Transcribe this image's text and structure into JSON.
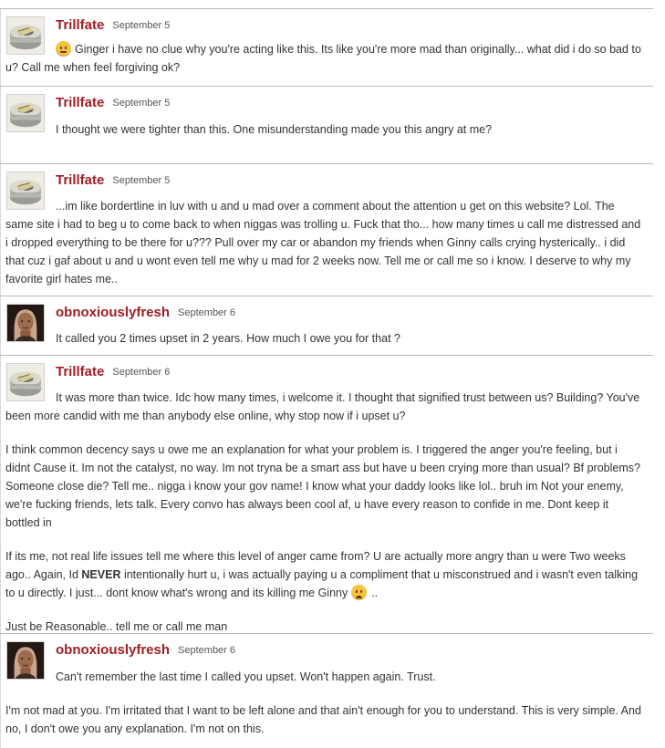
{
  "posts": [
    {
      "author": "Trillfate",
      "date": "September 5",
      "avatar": "tape-roll-avatar",
      "paragraphs": [
        "Ginger i have no clue why you're acting like this. Its like you're more mad than originally... what did i do so bad to u? Call me when feel forgiving ok?"
      ]
    },
    {
      "author": "Trillfate",
      "date": "September 5",
      "avatar": "tape-roll-avatar",
      "paragraphs": [
        "I thought we were tighter than this. One misunderstanding made you this angry at me?"
      ]
    },
    {
      "author": "Trillfate",
      "date": "September 5",
      "avatar": "tape-roll-avatar",
      "paragraphs": [
        "...im like bordertline in luv with u and u mad over a comment about the attention u get on this website? Lol. The same site i had to beg u to come back to when niggas was trolling u. Fuck that tho... how many times u call me distressed and i dropped everything to be there for u??? Pull over my car or abandon my friends when Ginny calls crying hysterically.. i did that cuz i gaf about u and u wont even tell me why u mad for 2 weeks now. Tell me or call me so i know. I deserve to why my favorite girl hates me.."
      ]
    },
    {
      "author": "obnoxiouslyfresh",
      "date": "September 6",
      "avatar": "woman-photo-avatar",
      "paragraphs": [
        "It called you 2 times upset in 2 years. How much I owe you for that ?"
      ]
    },
    {
      "author": "Trillfate",
      "date": "September 6",
      "avatar": "tape-roll-avatar",
      "paragraphs": [
        "It was more than twice. Idc how many times, i welcome it. I thought that signified trust between us? Building? You've been more candid with me than anybody else online, why stop now if i upset u?",
        "I think common decency says u owe me an explanation for what your problem is. I triggered the anger you're feeling, but i didnt Cause it. Im not the catalyst, no way. Im not tryna be a smart ass but have u been crying more than usual? Bf problems? Someone close die? Tell me.. nigga i know your gov name! I know what your daddy looks like lol.. bruh im Not your enemy, we're fucking friends, lets talk. Every convo has always been cool af, u have every reason to confide in me. Dont keep it bottled in"
      ],
      "p3_before_bold": "If its me, not real life issues tell me where this level of anger came from? U are actually more angry than u were Two weeks ago.. Again, Id ",
      "p3_bold": "NEVER",
      "p3_after_bold": " intentionally hurt u, i was actually paying u a compliment that u misconstrued and i wasn't even talking to u directly. I just... dont know what's wrong and its killing me Ginny",
      "p3_tail": " ..",
      "p4": "Just be Reasonable.. tell me or call me man"
    },
    {
      "author": "obnoxiouslyfresh",
      "date": "September 6",
      "avatar": "woman-photo-avatar",
      "paragraphs": [
        "Can't remember the last time I called you upset. Won't happen again. Trust.",
        "I'm not mad at you. I'm irritated that I want to be left alone and that ain't enough for you to understand. This is very simple. And no, I don't owe you any explanation. I'm not on this."
      ]
    }
  ],
  "colors": {
    "author": "#a01d26",
    "text": "#333333",
    "divider": "#b9b9b9",
    "emoji": "#f5c33b"
  },
  "icons": {
    "post1_emoji": "confused-face-emoji",
    "post5_emoji": "tired-face-emoji"
  }
}
